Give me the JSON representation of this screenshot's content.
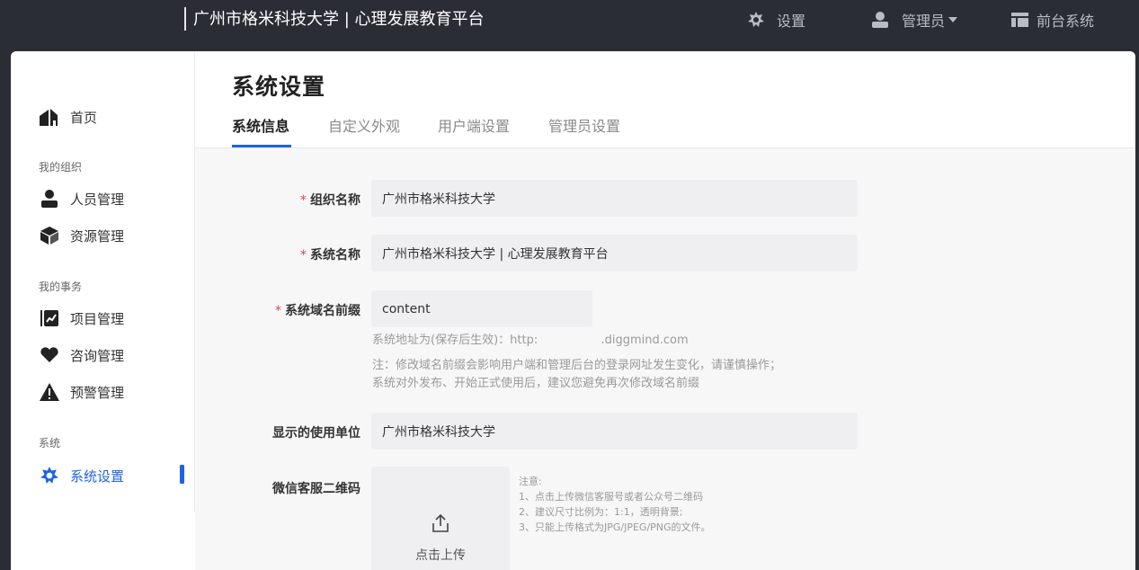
{
  "header": {
    "brand": "广州市格米科技大学 | 心理发展教育平台",
    "settings_label": "设置",
    "admin_label": "管理员",
    "frontend_label": "前台系统"
  },
  "sidebar": {
    "home": "首页",
    "group_org": "我的组织",
    "people": "人员管理",
    "resources": "资源管理",
    "group_affairs": "我的事务",
    "projects": "项目管理",
    "consulting": "咨询管理",
    "alerts": "预警管理",
    "group_system": "系统",
    "system_settings": "系统设置"
  },
  "page": {
    "title": "系统设置",
    "tabs": [
      "系统信息",
      "自定义外观",
      "用户端设置",
      "管理员设置"
    ]
  },
  "form": {
    "org_name_label": "组织名称",
    "org_name_value": "广州市格米科技大学",
    "sys_name_label": "系统名称",
    "sys_name_value": "广州市格米科技大学 | 心理发展教育平台",
    "domain_label": "系统域名前缀",
    "domain_value": "content",
    "domain_hint": "系统地址为(保存后生效)：http:                 .diggmind.com",
    "domain_note_1": "注：修改域名前缀会影响用户端和管理后台的登录网址发生变化，请谨慎操作；",
    "domain_note_2": "系统对外发布、开始正式使用后，建议您避免再次修改域名前缀",
    "unit_label": "显示的使用单位",
    "unit_value": "广州市格米科技大学",
    "qr_label": "微信客服二维码",
    "upload_label": "点击上传",
    "qr_notes": [
      "注意:",
      "1、点击上传微信客服号或者公众号二维码",
      "2、建议尺寸比例为：1:1，透明背景;",
      "3、只能上传格式为JPG/JPEG/PNG的文件。"
    ]
  },
  "colors": {
    "accent": "#1e62e6",
    "topbar": "#2b2d35",
    "required": "#e0464a"
  }
}
